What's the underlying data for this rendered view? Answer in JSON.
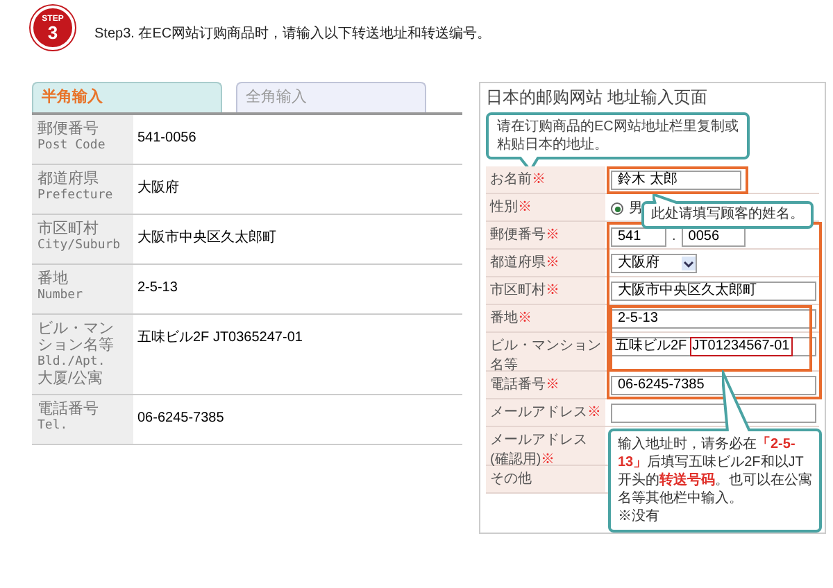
{
  "step_badge": {
    "label": "STEP",
    "number": "3"
  },
  "heading": "Step3. 在EC网站订购商品时，请输入以下转送地址和转送编号。",
  "tabs": [
    {
      "label": "半角输入",
      "selected": true
    },
    {
      "label": "全角输入",
      "selected": false
    }
  ],
  "address_table": [
    {
      "label": "郵便番号",
      "label_en": "Post Code",
      "value": "541-0056"
    },
    {
      "label": "都道府県",
      "label_en": "Prefecture",
      "value": "大阪府"
    },
    {
      "label": "市区町村",
      "label_en": "City/Suburb",
      "value": "大阪市中央区久太郎町"
    },
    {
      "label": "番地",
      "label_en": "Number",
      "value": "2-5-13"
    },
    {
      "label": "ビル・マンション名等",
      "label_en": "Bld./Apt.",
      "label_zh": "大厦/公寓",
      "value": "五味ビル2F JT0365247-01"
    },
    {
      "label": "電話番号",
      "label_en": "Tel.",
      "value": "06-6245-7385"
    }
  ],
  "example_page": {
    "title": "日本的邮购网站 地址输入页面",
    "callout": "请在订购商品的EC网站地址栏里复制或粘贴日本的地址。",
    "fields": [
      {
        "kind": "text",
        "label": "お名前",
        "mark": "※",
        "value": "鈴木 太郎"
      },
      {
        "kind": "radio",
        "label": "性別",
        "mark": "※",
        "option": "男",
        "checked": true
      },
      {
        "kind": "postal",
        "label": "郵便番号",
        "mark": "※",
        "value": "541",
        "separator": ".",
        "value2": "0056"
      },
      {
        "kind": "select",
        "label": "都道府県",
        "mark": "※",
        "value": "大阪府"
      },
      {
        "kind": "text",
        "label": "市区町村",
        "mark": "※",
        "value": "大阪市中央区久太郎町"
      },
      {
        "kind": "text",
        "label": "番地",
        "mark": "※",
        "value": "2-5-13"
      },
      {
        "kind": "building",
        "label": "ビル・マンション名等",
        "value": "五味ビル2F",
        "value2": "JT01234567-01"
      },
      {
        "kind": "text",
        "label": "電話番号",
        "mark": "※",
        "value": "06-6245-7385"
      },
      {
        "kind": "text",
        "label": "メールアドレス",
        "mark": "※"
      },
      {
        "kind": "hidden",
        "label": "メールアドレス(確認用)",
        "mark": "※"
      },
      {
        "kind": "hidden",
        "label": "その他"
      }
    ],
    "name_callout": "此处请填写顾客的姓名。",
    "notice": "输入地址时，请务必在**「2-5-13」**后填写五味ビル2F和以JT开头的**转送号码**。也可以在公寓名等其他栏中输入。",
    "notice_note": "※没有"
  }
}
